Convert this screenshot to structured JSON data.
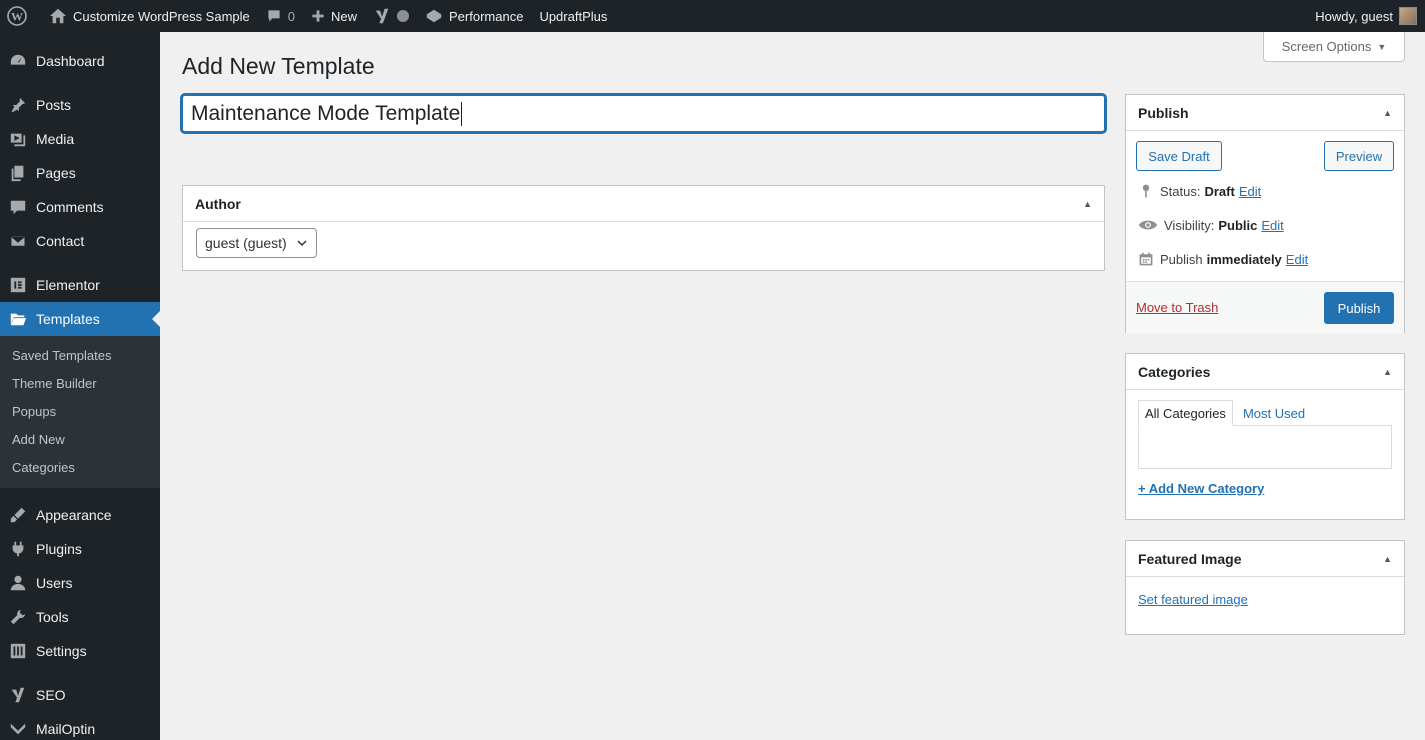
{
  "adminbar": {
    "site_name": "Customize WordPress Sample",
    "comments_count": "0",
    "new_label": "New",
    "performance_label": "Performance",
    "updraft_label": "UpdraftPlus",
    "howdy": "Howdy, guest"
  },
  "sidebar": {
    "items": [
      {
        "label": "Dashboard",
        "icon": "dashboard-icon"
      },
      {
        "label": "Posts",
        "icon": "pin-icon"
      },
      {
        "label": "Media",
        "icon": "media-icon"
      },
      {
        "label": "Pages",
        "icon": "pages-icon"
      },
      {
        "label": "Comments",
        "icon": "comment-icon"
      },
      {
        "label": "Contact",
        "icon": "mail-icon"
      },
      {
        "label": "Elementor",
        "icon": "elementor-icon"
      },
      {
        "label": "Templates",
        "icon": "folder-icon"
      },
      {
        "label": "Appearance",
        "icon": "paintbrush-icon"
      },
      {
        "label": "Plugins",
        "icon": "plugin-icon"
      },
      {
        "label": "Users",
        "icon": "user-icon"
      },
      {
        "label": "Tools",
        "icon": "wrench-icon"
      },
      {
        "label": "Settings",
        "icon": "settings-icon"
      },
      {
        "label": "SEO",
        "icon": "yoast-icon"
      },
      {
        "label": "MailOptin",
        "icon": "mailoptin-icon"
      }
    ],
    "submenu": [
      "Saved Templates",
      "Theme Builder",
      "Popups",
      "Add New",
      "Categories"
    ]
  },
  "screen_options": "Screen Options",
  "page_title": "Add New Template",
  "title_value": "Maintenance Mode Template",
  "author": {
    "title": "Author",
    "selected": "guest (guest)"
  },
  "publish": {
    "title": "Publish",
    "save_draft": "Save Draft",
    "preview": "Preview",
    "status_label": "Status:",
    "status_value": "Draft",
    "visibility_label": "Visibility:",
    "visibility_value": "Public",
    "publish_label": "Publish",
    "publish_value": "immediately",
    "edit": "Edit",
    "trash": "Move to Trash",
    "publish_button": "Publish"
  },
  "categories": {
    "title": "Categories",
    "tab_all": "All Categories",
    "tab_most_used": "Most Used",
    "add_new": "+ Add New Category"
  },
  "featured": {
    "title": "Featured Image",
    "set": "Set featured image"
  },
  "colors": {
    "accent": "#2271b1",
    "sidebar_bg": "#1d2327",
    "trash": "#b32d2e"
  }
}
